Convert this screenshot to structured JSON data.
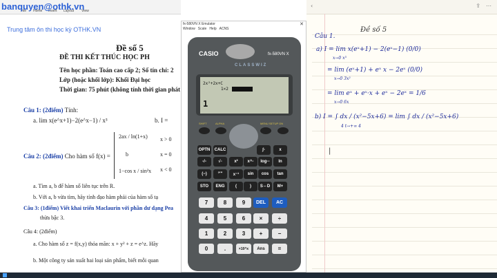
{
  "watermark": {
    "email": "banquyen@othk.vn",
    "center": "Trung tâm ôn thi học kỳ OTHK.VN"
  },
  "doc": {
    "title": "Đề số 5",
    "header_line": "ĐỀ THI KẾT THÚC HỌC PH",
    "subject": "Tên học phần: Toán cao cấp 2; Số tín chỉ: 2",
    "class": "Lớp (hoặc khối lớp): Khối Đại học",
    "time": "Thời gian: 75 phút (không tính thời gian phát đ",
    "q1_label": "Câu 1: (2điểm)",
    "q1_text": "Tính:",
    "q1a": "a.  lim x(e^x+1)−2(e^x−1) / x³",
    "q1b": "b.  I =",
    "q2_label": "Câu 2: (2điểm)",
    "q2_text": "Cho hàm số  f(x) =",
    "q2_pieces": [
      "2ax / ln(1+x)",
      "b",
      "1−cos x / sin²x"
    ],
    "q2_conds": [
      "x > 0",
      "x = 0",
      "x < 0"
    ],
    "q2a": "a.  Tìm a, b để hàm số liên tục trên R.",
    "q2b": "b.  Với a, b vừa tìm, hãy tính đạo hàm phải của hàm số tạ",
    "q3": "Câu 3: (1điểm) Viết khai triển Maclaurin với phần dư dạng Pea",
    "q3b": "thừa bậc 3.",
    "q4_label": "Câu 4: (2điểm)",
    "q4a": "a.  Cho hàm số z = f(x,y) thỏa mãn: x + y² + z = e^z. Hãy",
    "q4b": "b.  Một công ty sản xuất hai loại sản phẩm, biết mỗi quan"
  },
  "calculator": {
    "window_title": "fx-580VN X Emulator",
    "menu": [
      "Window",
      "Scale",
      "Help",
      "ACNS"
    ],
    "brand": "CASIO",
    "model": "fx-580VN X",
    "series": "CLASSWIZ",
    "lcd_line1": "2x²+2x+C",
    "lcd_line2": "1×2",
    "lcd_result": "1",
    "func_labels": [
      "SHIFT",
      "ALPHA",
      "MENU SETUP",
      "ON"
    ],
    "row1": [
      "OPTN",
      "CALC",
      "∫▫",
      "x"
    ],
    "row2": [
      "▫/▫",
      "√▫",
      "x²",
      "x^▫",
      "log▫▫",
      "ln"
    ],
    "row3": [
      "(−)",
      "°'\"",
      "x⁻¹",
      "sin",
      "cos",
      "tan"
    ],
    "row4": [
      "STO",
      "ENG",
      "(",
      ")",
      "S⇔D",
      "M+"
    ],
    "num_rows": [
      [
        "7",
        "8",
        "9",
        "DEL",
        "AC"
      ],
      [
        "4",
        "5",
        "6",
        "×",
        "÷"
      ],
      [
        "1",
        "2",
        "3",
        "+",
        "−"
      ],
      [
        "0",
        ".",
        "×10^x",
        "Ans",
        "="
      ]
    ]
  },
  "notes": {
    "header": "Đề số 5",
    "cau": "Câu 1.",
    "line_a1": "a)  I = lim   x(eˣ+1) − 2(eˣ−1)      (0/0)",
    "line_a1_sub": "x→0              x³",
    "line_a2": "= lim  (eˣ+1) + eˣ x − 2eˣ      (0/0)",
    "line_a2_sub": "x→0            3x²",
    "line_a3": "= lim  eˣ + eˣ·x + eˣ − 2eˣ   =  1/6",
    "line_a3_sub": "x→0           6x",
    "line_b": "b)  I = ∫ dx / (x²−5x+6) = lim ∫ dx / (x²−5x+6)",
    "line_b_sub": "4            t→+∞ 4",
    "cursor": "|"
  }
}
